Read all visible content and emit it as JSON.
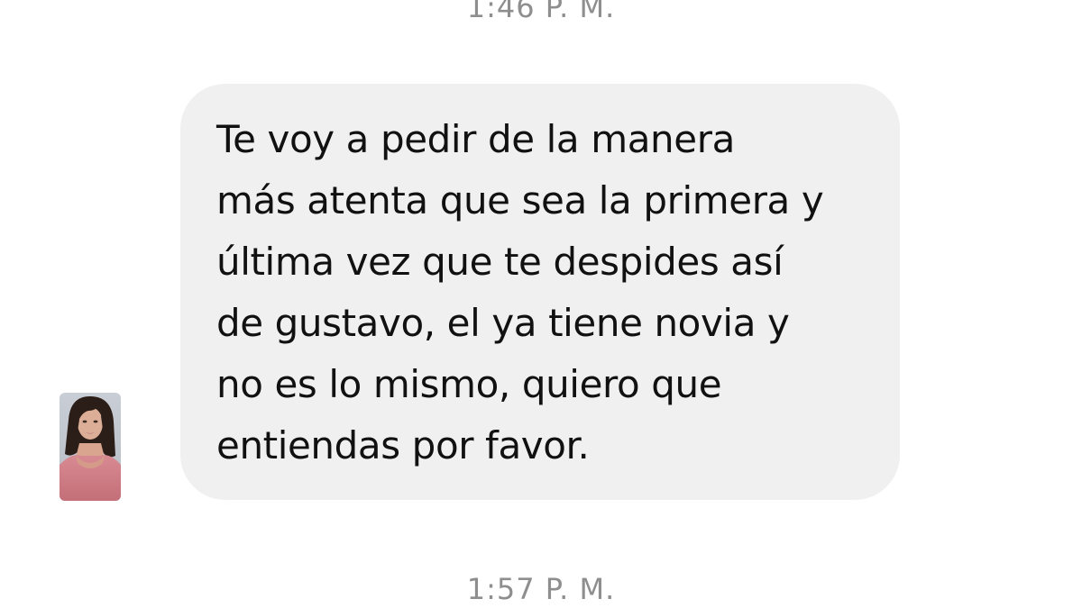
{
  "conversation": {
    "timestamp_top": "1:46 P. M.",
    "timestamp_bottom": "1:57 P. M.",
    "message": {
      "text": "Te voy a pedir de la manera\nmás atenta que sea la primera y\núltima vez que te despides así\nde gustavo, el ya tiene novia y\nno es lo mismo, quiero que\nentiendas por favor."
    }
  },
  "colors": {
    "background": "#ffffff",
    "bubble": "#f0f0f0",
    "message_text": "#111111",
    "timestamp": "#8e8e8e"
  }
}
